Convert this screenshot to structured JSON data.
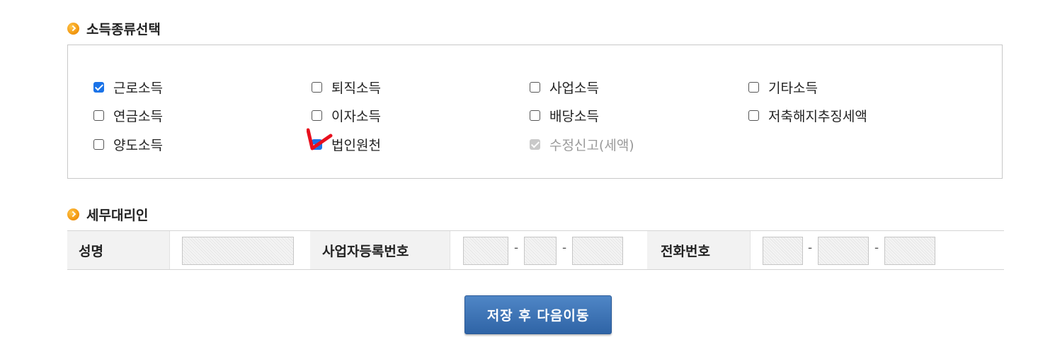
{
  "income_section": {
    "title": "소득종류선택",
    "options": [
      {
        "label": "근로소득",
        "checked": true
      },
      {
        "label": "퇴직소득",
        "checked": false
      },
      {
        "label": "사업소득",
        "checked": false
      },
      {
        "label": "기타소득",
        "checked": false
      },
      {
        "label": "연금소득",
        "checked": false
      },
      {
        "label": "이자소득",
        "checked": false
      },
      {
        "label": "배당소득",
        "checked": false
      },
      {
        "label": "저축해지추징세액",
        "checked": false
      },
      {
        "label": "양도소득",
        "checked": false
      },
      {
        "label": "법인원천",
        "checked": true
      },
      {
        "label": "수정신고(세액)",
        "checked": true,
        "disabled": true
      }
    ]
  },
  "agent_section": {
    "title": "세무대리인",
    "name_label": "성명",
    "name_value": "",
    "bizno_label": "사업자등록번호",
    "bizno_parts": [
      "",
      "",
      ""
    ],
    "phone_label": "전화번호",
    "phone_parts": [
      "",
      "",
      ""
    ],
    "separator": "-"
  },
  "save_button": {
    "label": "저장 후 다음이동"
  },
  "colors": {
    "accent_blue": "#2f64a6",
    "checkbox_blue": "#1a73e8",
    "annotation_red": "#e8101e",
    "bullet_orange": "#f39a12"
  }
}
